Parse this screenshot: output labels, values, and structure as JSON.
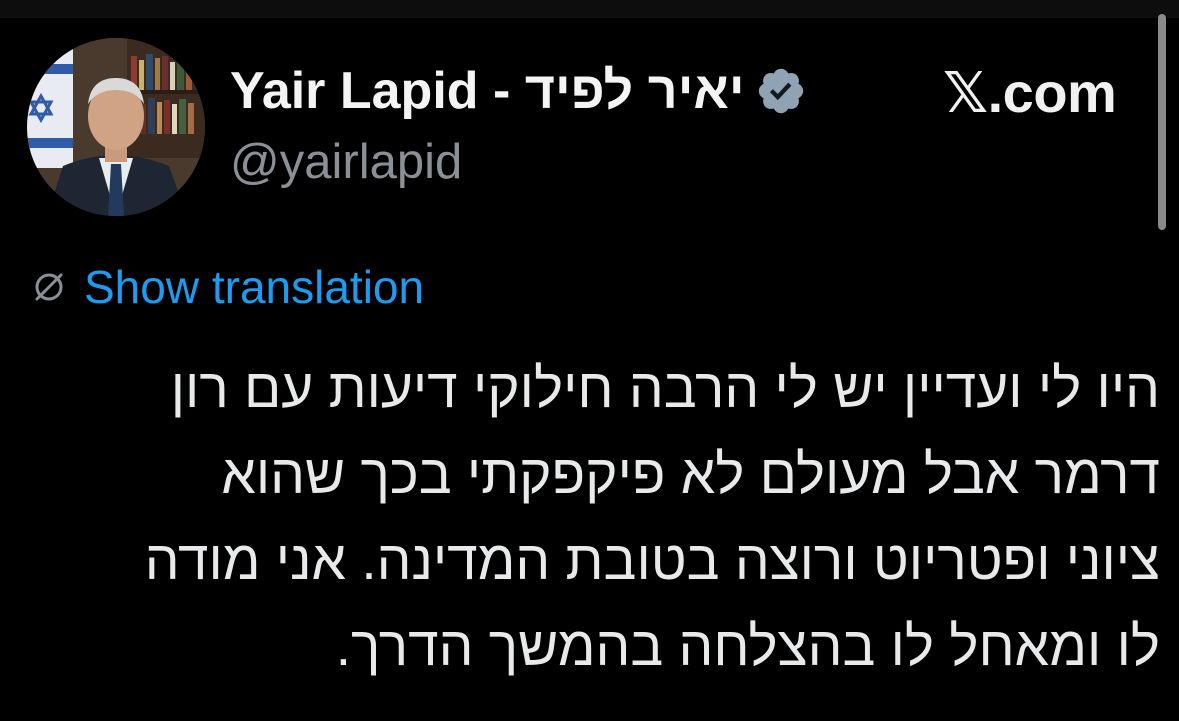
{
  "tweet": {
    "author": {
      "display_name": "Yair Lapid - יאיר לפיד",
      "handle": "@yairlapid",
      "verified": true,
      "avatar_icon": "profile-photo"
    },
    "source_label": "𝕏.com",
    "translation": {
      "label": "Show translation",
      "icon": "globe-off-icon"
    },
    "text_lines": [
      "היו לי ועדיין יש לי הרבה חילוקי דיעות עם רון",
      "דרמר אבל מעולם לא פיקפקתי בכך שהוא",
      "ציוני ופטריוט ורוצה בטובת המדינה. אני מודה",
      "לו ומאחל לו בהצלחה בהמשך הדרך."
    ]
  },
  "colors": {
    "background": "#000000",
    "primary_text": "#e7e9ea",
    "secondary_text": "#8b9096",
    "link": "#1d9bf0",
    "verified_badge": "#8fa3b5"
  }
}
